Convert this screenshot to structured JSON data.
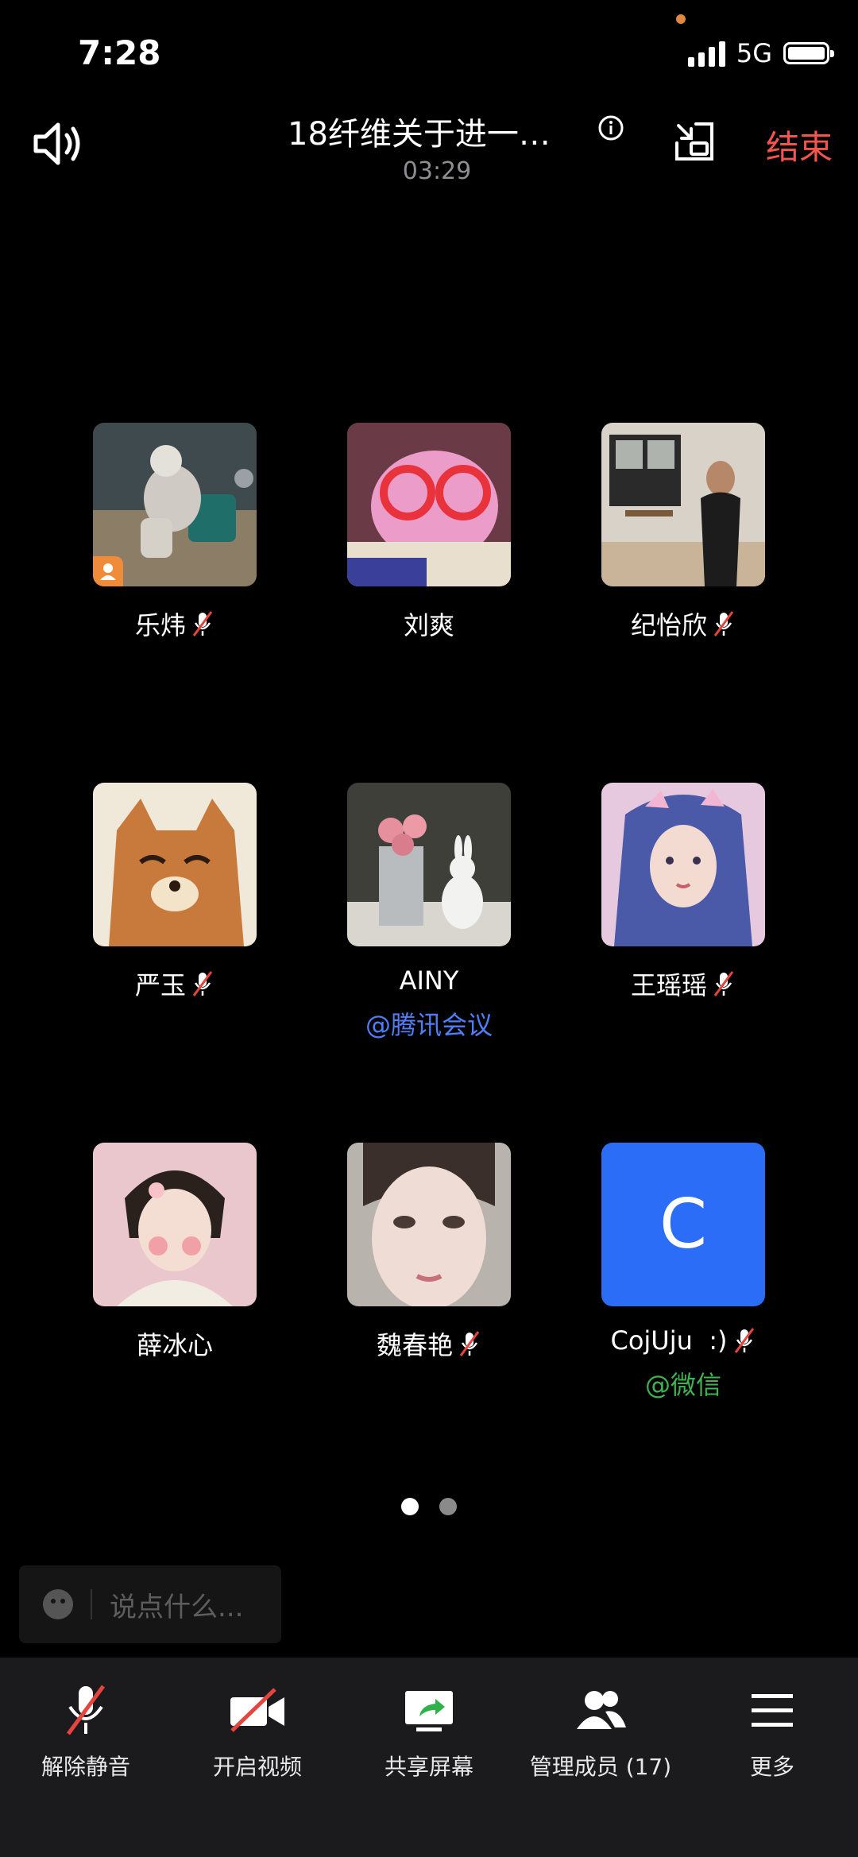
{
  "status_bar": {
    "time": "7:28",
    "network": "5G"
  },
  "header": {
    "title": "18纤维关于进一…",
    "timer": "03:29",
    "end_label": "结束"
  },
  "participants": [
    {
      "name": "乐炜",
      "muted": true,
      "host": true,
      "source": ""
    },
    {
      "name": "刘爽",
      "muted": false,
      "source": ""
    },
    {
      "name": "纪怡欣",
      "muted": true,
      "source": ""
    },
    {
      "name": "严玉",
      "muted": true,
      "source": ""
    },
    {
      "name": "AINY",
      "muted": false,
      "source": "@腾讯会议"
    },
    {
      "name": "王瑶瑶",
      "muted": true,
      "source": ""
    },
    {
      "name": "薛冰心",
      "muted": false,
      "source": ""
    },
    {
      "name": "魏春艳",
      "muted": true,
      "source": ""
    },
    {
      "name": "CojUju  :)",
      "muted": true,
      "source": "@微信",
      "initial": "C"
    }
  ],
  "pager": {
    "current": 1,
    "total": 2
  },
  "chat": {
    "placeholder": "说点什么..."
  },
  "toolbar": [
    {
      "label": "解除静音",
      "icon": "mic-muted-icon"
    },
    {
      "label": "开启视频",
      "icon": "video-off-icon"
    },
    {
      "label": "共享屏幕",
      "icon": "share-screen-icon"
    },
    {
      "label": "管理成员 (17)",
      "icon": "members-icon"
    },
    {
      "label": "更多",
      "icon": "menu-icon"
    }
  ],
  "colors": {
    "end": "#f2554e",
    "tencent_source": "#4f7ef7",
    "wechat_source": "#3fb34f",
    "letter_avatar": "#2b6df6",
    "host_badge": "#f08b3a"
  }
}
